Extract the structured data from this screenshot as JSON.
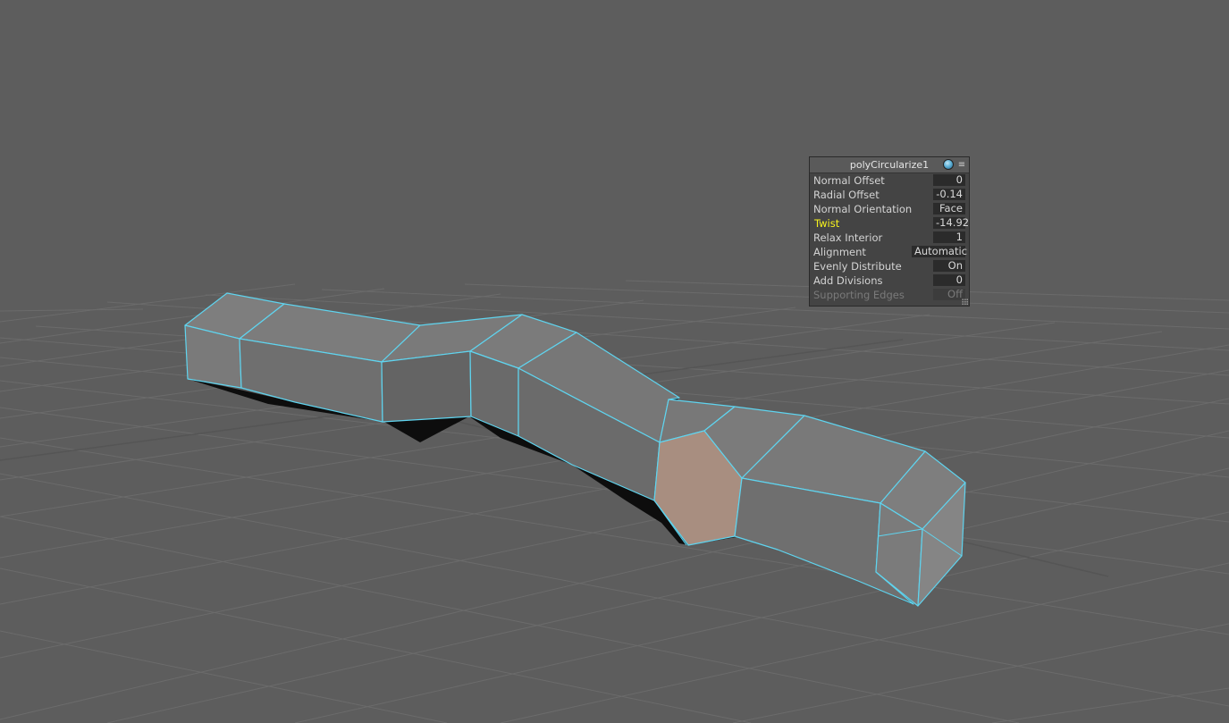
{
  "viewport": {
    "background_color": "#5d5d5d",
    "grid_color": "#6e6e6e",
    "wireframe_color": "#5fd4ef",
    "selected_face_color": "#a88e80"
  },
  "hud": {
    "title": "polyCircularize1",
    "icons": {
      "shading": "shaded-sphere-icon",
      "menu": "menu-icon"
    },
    "menu_glyph": "≡",
    "rows": [
      {
        "label": "Normal Offset",
        "value": "0",
        "state": "normal"
      },
      {
        "label": "Radial Offset",
        "value": "-0.14",
        "state": "normal"
      },
      {
        "label": "Normal Orientation",
        "value": "Face",
        "state": "normal"
      },
      {
        "label": "Twist",
        "value": "-14.92",
        "state": "active"
      },
      {
        "label": "Relax Interior",
        "value": "1",
        "state": "normal"
      },
      {
        "label": "Alignment",
        "value": "Automatic",
        "state": "normal"
      },
      {
        "label": "Evenly Distribute",
        "value": "On",
        "state": "normal"
      },
      {
        "label": "Add Divisions",
        "value": "0",
        "state": "normal"
      },
      {
        "label": "Supporting Edges",
        "value": "Off",
        "state": "disabled"
      }
    ],
    "active_color": "#f6f21e"
  }
}
